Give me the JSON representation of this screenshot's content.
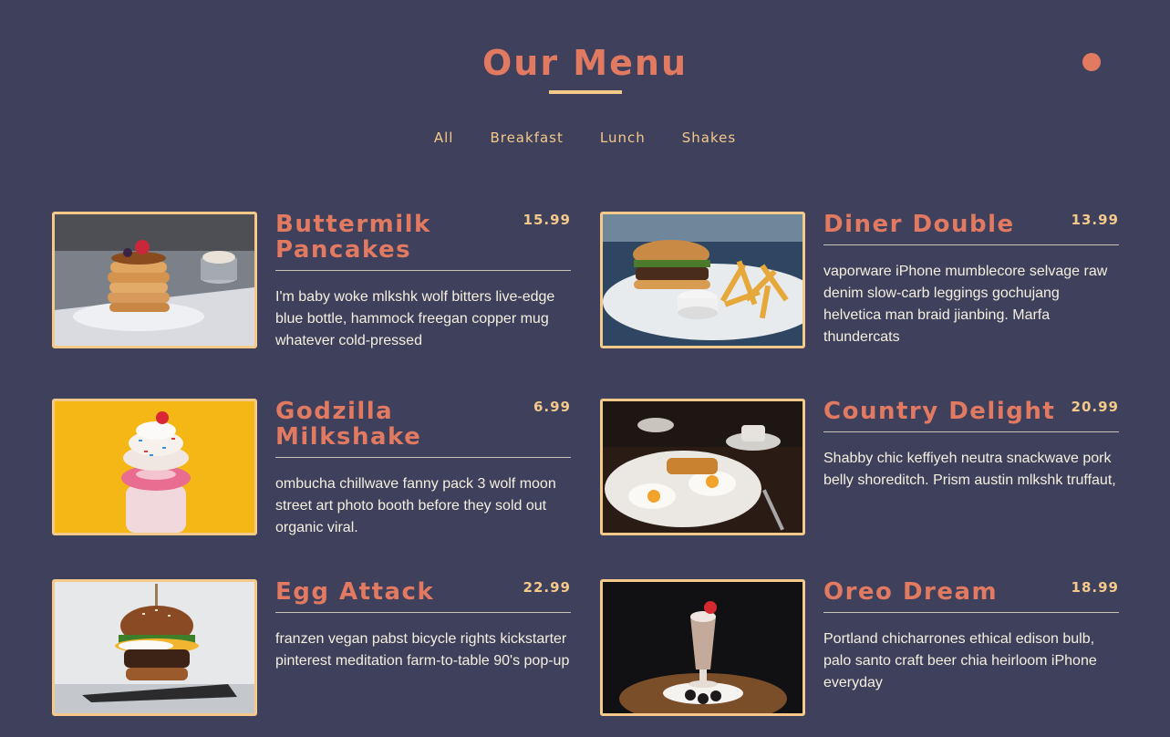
{
  "header": {
    "title": "Our Menu"
  },
  "filters": [
    "All",
    "Breakfast",
    "Lunch",
    "Shakes"
  ],
  "colors": {
    "background": "#3e405c",
    "accent": "#e27a62",
    "gold": "#f4c98a",
    "text": "#f5efe0"
  },
  "menu": [
    {
      "name": "Buttermilk Pancakes",
      "price": "15.99",
      "description": "I'm baby woke mlkshk wolf bitters live-edge blue bottle, hammock freegan copper mug whatever cold-pressed"
    },
    {
      "name": "Diner Double",
      "price": "13.99",
      "description": "vaporware iPhone mumblecore selvage raw denim slow-carb leggings gochujang helvetica man braid jianbing. Marfa thundercats"
    },
    {
      "name": "Godzilla Milkshake",
      "price": "6.99",
      "description": "ombucha chillwave fanny pack 3 wolf moon street art photo booth before they sold out organic viral."
    },
    {
      "name": "Country Delight",
      "price": "20.99",
      "description": "Shabby chic keffiyeh neutra snackwave pork belly shoreditch. Prism austin mlkshk truffaut,"
    },
    {
      "name": "Egg Attack",
      "price": "22.99",
      "description": "franzen vegan pabst bicycle rights kickstarter pinterest meditation farm-to-table 90's pop-up"
    },
    {
      "name": "Oreo Dream",
      "price": "18.99",
      "description": "Portland chicharrones ethical edison bulb, palo santo craft beer chia heirloom iPhone everyday"
    }
  ]
}
